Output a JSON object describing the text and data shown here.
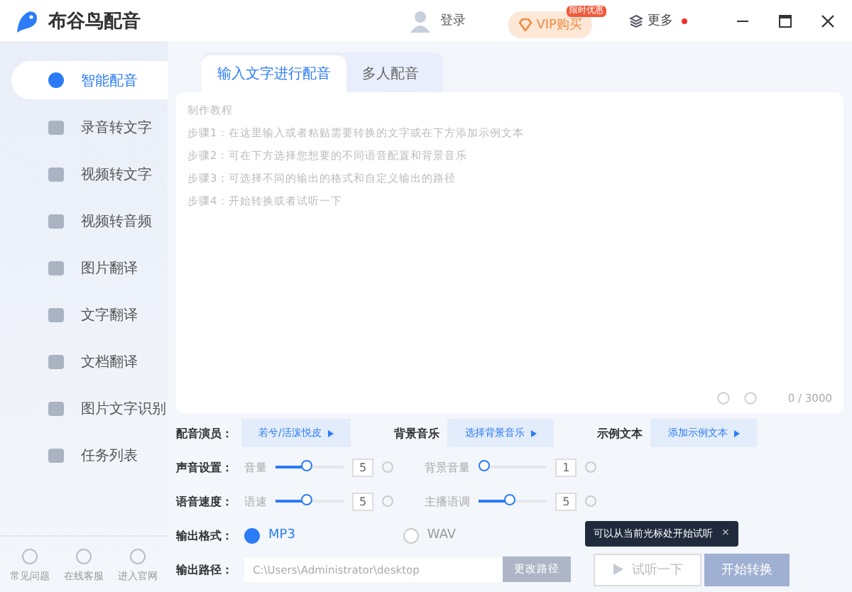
{
  "window": {
    "title": "布谷鸟配音",
    "login": "登录",
    "vip": "VIP购买",
    "vip_badge": "限时优惠",
    "more": "更多"
  },
  "sidebar": {
    "items": [
      {
        "label": "智能配音",
        "selected": true
      },
      {
        "label": "录音转文字",
        "selected": false
      },
      {
        "label": "视频转文字",
        "selected": false
      },
      {
        "label": "视频转音频",
        "selected": false
      },
      {
        "label": "图片翻译",
        "selected": false
      },
      {
        "label": "文字翻译",
        "selected": false
      },
      {
        "label": "文档翻译",
        "selected": false
      },
      {
        "label": "图片文字识别",
        "selected": false
      },
      {
        "label": "任务列表",
        "selected": false
      }
    ],
    "footer": [
      "常见问题",
      "在线客服",
      "进入官网"
    ]
  },
  "tabs": [
    {
      "label": "输入文字进行配音",
      "selected": true
    },
    {
      "label": "多人配音",
      "selected": false
    }
  ],
  "editor": {
    "placeholder_lines": [
      "制作教程",
      "步骤1：在这里输入或者粘贴需要转换的文字或在下方添加示例文本",
      "步骤2：可在下方选择您想要的不同语音配置和背景音乐",
      "步骤3：可选择不同的输出的格式和自定义输出的路径",
      "步骤4：开始转换或者试听一下"
    ],
    "counter": "0 / 3000"
  },
  "pickers": [
    {
      "label": "配音演员：",
      "button": "若兮/活泼悦皮"
    },
    {
      "label": "背景音乐",
      "button": "选择背景音乐"
    },
    {
      "label": "示例文本",
      "button": "添加示例文本"
    }
  ],
  "slider_rows": [
    {
      "label": "声音设置：",
      "sliders": [
        {
          "name": "音量",
          "level": 0.45,
          "value": "5"
        },
        {
          "name": "背景音量",
          "level": 0,
          "value": "1"
        }
      ]
    },
    {
      "label": "语音速度：",
      "sliders": [
        {
          "name": "语速",
          "level": 0.45,
          "value": "5"
        },
        {
          "name": "主播语调",
          "level": 0.45,
          "value": "5"
        }
      ]
    }
  ],
  "format": {
    "label": "输出格式：",
    "options": [
      {
        "label": "MP3",
        "selected": true
      },
      {
        "label": "WAV",
        "selected": false
      }
    ]
  },
  "path": {
    "label": "输出路径：",
    "value": "C:\\Users\\Administrator\\desktop",
    "button": "更改路径"
  },
  "tooltip": "可以从当前光标处开始试听",
  "tooltip_close": "×",
  "actions": {
    "preview": "试听一下",
    "convert": "开始转换"
  }
}
